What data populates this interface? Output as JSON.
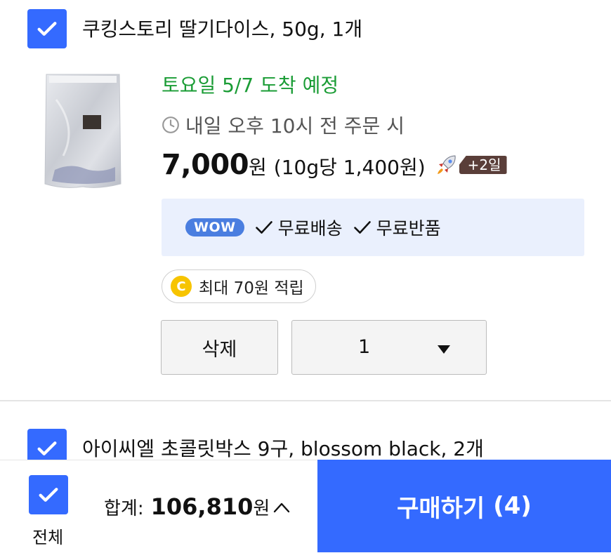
{
  "items": [
    {
      "title": "쿠킹스토리 딸기다이스, 50g, 1개",
      "checked": true,
      "arrival": "토요일 5/7 도착 예정",
      "order_deadline": "내일 오후 10시 전 주문 시",
      "price": "7,000",
      "price_unit": "원",
      "unit_price": "(10g당 1,400원)",
      "delivery_badge": "+2일",
      "wow_badge": "WOW",
      "benefits": [
        "무료배송",
        "무료반품"
      ],
      "cash_icon_letter": "C",
      "cash_reward": "최대 70원 적립",
      "delete_label": "삭제",
      "quantity": "1"
    },
    {
      "title": "아이씨엘 초콜릿박스 9구, blossom black, 2개",
      "checked": true
    }
  ],
  "footer": {
    "select_all_label": "전체",
    "total_label": "합계:",
    "total_amount": "106,810",
    "total_unit": "원",
    "buy_button_label": "구매하기",
    "buy_count": "(4)"
  },
  "colors": {
    "accent": "#346aff",
    "arrival_green": "#1a9c35",
    "benefit_bg": "#eaf0fd",
    "wow": "#4a7ee0",
    "days_badge": "#5a3e39",
    "coin": "#f7c400"
  },
  "icons": [
    "checkmark-icon",
    "clock-icon",
    "rocket-icon",
    "check-icon",
    "coin-icon",
    "caret-down-icon",
    "chevron-up-icon"
  ]
}
